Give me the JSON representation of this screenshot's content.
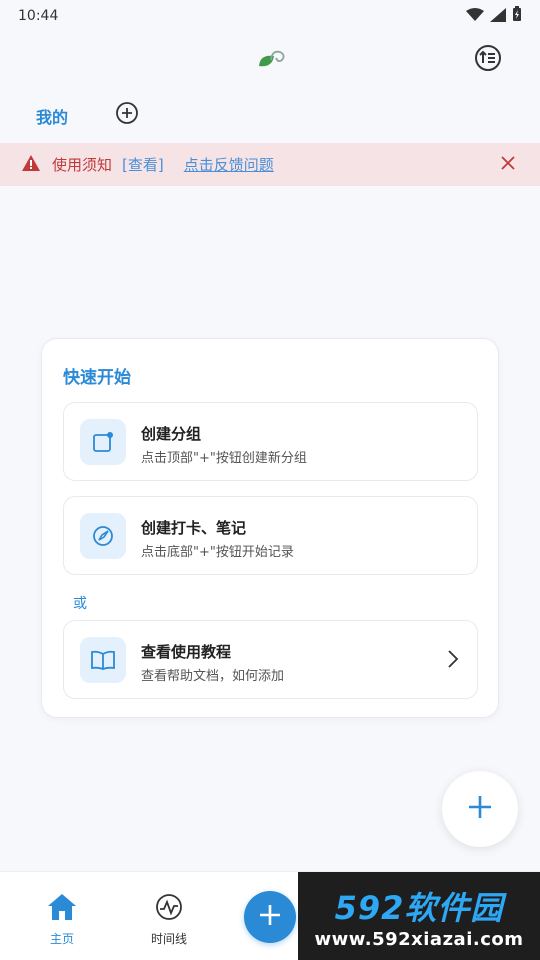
{
  "status_bar": {
    "time": "10:44"
  },
  "tabs": {
    "mine_label": "我的"
  },
  "notice": {
    "text": "使用须知",
    "view_link": "[查看]",
    "feedback_link": "点击反馈问题"
  },
  "quick_start": {
    "title": "快速开始",
    "options": [
      {
        "title": "创建分组",
        "subtitle": "点击顶部\"+\"按钮创建新分组",
        "icon": "new-group-icon"
      },
      {
        "title": "创建打卡、笔记",
        "subtitle": "点击底部\"+\"按钮开始记录",
        "icon": "compass-icon"
      }
    ],
    "or_label": "或",
    "tutorial": {
      "title": "查看使用教程",
      "subtitle": "查看帮助文档，如何添加",
      "icon": "book-icon"
    }
  },
  "bottom_nav": {
    "items": [
      {
        "label": "主页",
        "icon": "home-icon"
      },
      {
        "label": "时间线",
        "icon": "timeline-icon"
      }
    ]
  },
  "watermark": {
    "logo": "592软件园",
    "url": "www.592xiazai.com"
  },
  "colors": {
    "accent": "#2b8ad6",
    "notice_bg": "#f6e3e6",
    "notice_red": "#c03a3a"
  }
}
